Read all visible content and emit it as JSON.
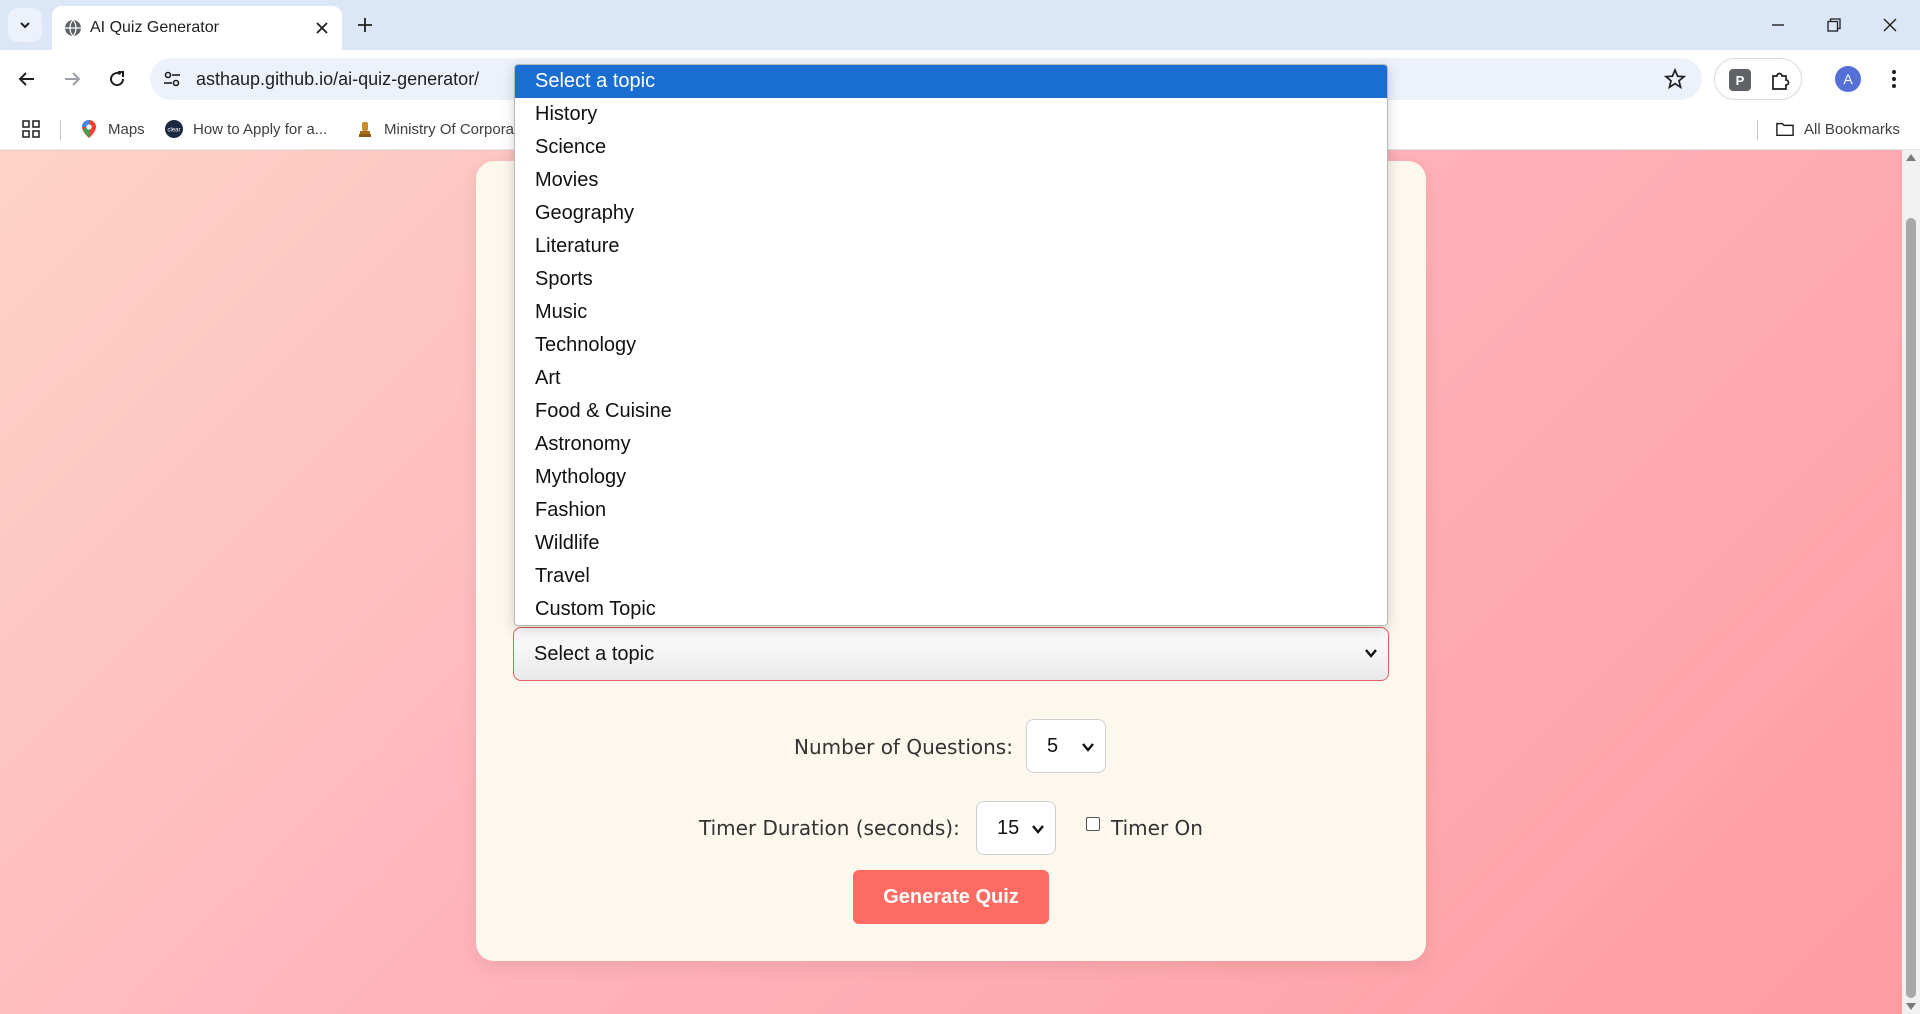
{
  "browser": {
    "tab_title": "AI Quiz Generator",
    "url": "asthaup.github.io/ai-quiz-generator/",
    "extension_label": "P",
    "profile_initial": "A"
  },
  "bookmarks": {
    "items": [
      "Maps",
      "How to Apply for a...",
      "Ministry Of Corpora"
    ],
    "all_bookmarks": "All Bookmarks"
  },
  "form": {
    "topic_selected": "Select a topic",
    "num_questions_label": "Number of Questions:",
    "num_questions_value": "5",
    "timer_label": "Timer Duration (seconds):",
    "timer_value": "15",
    "timer_on_label": "Timer On",
    "generate_label": "Generate Quiz"
  },
  "dropdown": {
    "options": [
      "Select a topic",
      "History",
      "Science",
      "Movies",
      "Geography",
      "Literature",
      "Sports",
      "Music",
      "Technology",
      "Art",
      "Food & Cuisine",
      "Astronomy",
      "Mythology",
      "Fashion",
      "Wildlife",
      "Travel",
      "Custom Topic"
    ]
  },
  "colors": {
    "accent": "#fe6b63",
    "selection": "#1a6dd1",
    "card": "#fdf8ee"
  }
}
